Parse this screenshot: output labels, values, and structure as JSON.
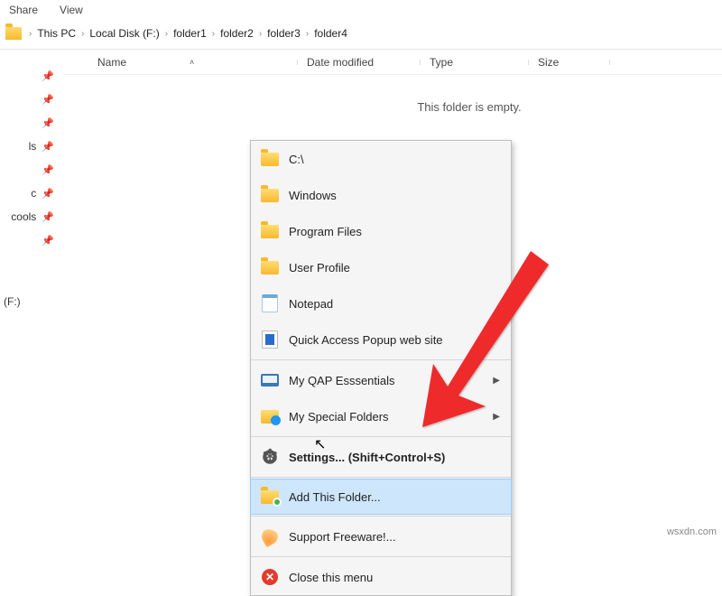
{
  "tabs": {
    "share": "Share",
    "view": "View"
  },
  "breadcrumb": [
    "This PC",
    "Local Disk (F:)",
    "folder1",
    "folder2",
    "folder3",
    "folder4"
  ],
  "columns": {
    "name": "Name",
    "date": "Date modified",
    "type": "Type",
    "size": "Size"
  },
  "empty_text": "This folder is empty.",
  "sidebar": {
    "items": [
      "",
      "",
      "",
      "ls",
      "",
      "c",
      "cools",
      ""
    ],
    "drive": "(F:)"
  },
  "menu": {
    "items": [
      {
        "label": "C:\\",
        "icon": "folder"
      },
      {
        "label": "Windows",
        "icon": "folder"
      },
      {
        "label": "Program Files",
        "icon": "folder"
      },
      {
        "label": "User Profile",
        "icon": "folder"
      },
      {
        "label": "Notepad",
        "icon": "notepad"
      },
      {
        "label": "Quick Access Popup web site",
        "icon": "web"
      },
      {
        "label": "My QAP Esssentials",
        "icon": "monitor",
        "sub": true
      },
      {
        "label": "My Special Folders",
        "icon": "bluefolder",
        "sub": true
      },
      {
        "label": "Settings... (Shift+Control+S)",
        "icon": "gear",
        "bold": true
      },
      {
        "label": "Add This Folder...",
        "icon": "folderplus",
        "sel": true
      },
      {
        "label": "Support Freeware!...",
        "icon": "feather"
      },
      {
        "label": "Close this menu",
        "icon": "closex"
      }
    ]
  },
  "watermark": "wsxdn.com"
}
